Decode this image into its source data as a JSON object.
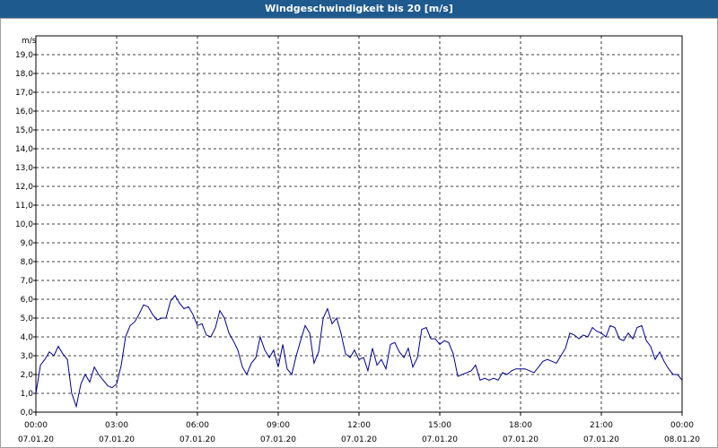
{
  "window": {
    "title": "Windgeschwindigkeit bis 20 [m/s]"
  },
  "colors": {
    "title_bg": "#1e5a8e",
    "line": "#00008b",
    "grid": "#000000"
  },
  "chart_data": {
    "type": "line",
    "title": "Windgeschwindigkeit bis 20 [m/s]",
    "ylabel": "m/s",
    "xlabel": "",
    "ylim": [
      0,
      20
    ],
    "xlim_hours": [
      0,
      24
    ],
    "grid": true,
    "y_ticks": [
      "0,0",
      "1,0",
      "2,0",
      "3,0",
      "4,0",
      "5,0",
      "6,0",
      "7,0",
      "8,0",
      "9,0",
      "10,0",
      "11,0",
      "12,0",
      "13,0",
      "14,0",
      "15,0",
      "16,0",
      "17,0",
      "18,0",
      "19,0"
    ],
    "x_ticks": [
      {
        "time": "00:00",
        "date": "07.01.20"
      },
      {
        "time": "03:00",
        "date": "07.01.20"
      },
      {
        "time": "06:00",
        "date": "07.01.20"
      },
      {
        "time": "09:00",
        "date": "07.01.20"
      },
      {
        "time": "12:00",
        "date": "07.01.20"
      },
      {
        "time": "15:00",
        "date": "07.01.20"
      },
      {
        "time": "18:00",
        "date": "07.01.20"
      },
      {
        "time": "21:00",
        "date": "07.01.20"
      },
      {
        "time": "00:00",
        "date": "08.01.20"
      }
    ],
    "series": [
      {
        "x_hours": [
          0,
          0.17,
          0.33,
          0.5,
          0.67,
          0.83,
          1,
          1.17,
          1.33,
          1.5,
          1.67,
          1.83,
          2,
          2.17,
          2.33,
          2.5,
          2.67,
          2.83,
          3,
          3.17,
          3.33,
          3.5,
          3.67,
          3.83,
          4,
          4.17,
          4.33,
          4.5,
          4.67,
          4.83,
          5,
          5.17,
          5.33,
          5.5,
          5.67,
          5.83,
          6,
          6.17,
          6.33,
          6.5,
          6.67,
          6.83,
          7,
          7.17,
          7.33,
          7.5,
          7.67,
          7.83,
          8,
          8.17,
          8.33,
          8.5,
          8.67,
          8.83,
          9,
          9.17,
          9.33,
          9.5,
          9.67,
          9.83,
          10,
          10.17,
          10.33,
          10.5,
          10.67,
          10.83,
          11,
          11.17,
          11.33,
          11.5,
          11.67,
          11.83,
          12,
          12.17,
          12.33,
          12.5,
          12.67,
          12.83,
          13,
          13.17,
          13.33,
          13.5,
          13.67,
          13.83,
          14,
          14.17,
          14.33,
          14.5,
          14.67,
          14.83,
          15,
          15.17,
          15.33,
          15.5,
          15.67,
          15.83,
          16,
          16.17,
          16.33,
          16.5,
          16.67,
          16.83,
          17,
          17.17,
          17.33,
          17.5,
          17.67,
          17.83,
          18,
          18.17,
          18.33,
          18.5,
          18.67,
          18.83,
          19,
          19.17,
          19.33,
          19.5,
          19.67,
          19.83,
          20,
          20.17,
          20.33,
          20.5,
          20.67,
          20.83,
          21,
          21.17,
          21.33,
          21.5,
          21.67,
          21.83,
          22,
          22.17,
          22.33,
          22.5,
          22.67,
          22.83,
          23,
          23.17,
          23.33,
          23.5,
          23.67,
          23.83,
          24
        ],
        "values": [
          1.0,
          2.5,
          2.8,
          3.2,
          3.0,
          3.5,
          3.1,
          2.8,
          1.0,
          0.3,
          1.5,
          2.0,
          1.6,
          2.4,
          2.0,
          1.7,
          1.4,
          1.3,
          1.5,
          2.5,
          4.0,
          4.6,
          4.8,
          5.2,
          5.7,
          5.6,
          5.2,
          4.9,
          5.0,
          5.0,
          5.9,
          6.2,
          5.8,
          5.5,
          5.6,
          5.2,
          4.6,
          4.7,
          4.1,
          4.0,
          4.5,
          5.4,
          5.0,
          4.2,
          3.8,
          3.3,
          2.4,
          2.0,
          2.6,
          2.9,
          4.0,
          3.3,
          2.9,
          3.3,
          2.4,
          3.6,
          2.3,
          2.0,
          3.0,
          3.8,
          4.6,
          4.2,
          2.6,
          3.2,
          5.0,
          5.5,
          4.7,
          5.0,
          4.2,
          3.1,
          2.9,
          3.3,
          2.8,
          2.9,
          2.2,
          3.4,
          2.5,
          2.8,
          2.3,
          3.6,
          3.7,
          3.2,
          2.9,
          3.4,
          2.4,
          2.9,
          4.4,
          4.5,
          3.9,
          3.9,
          3.6,
          3.8,
          3.7,
          3.1,
          1.9,
          2.0,
          2.1,
          2.2,
          2.5,
          1.7,
          1.8,
          1.7,
          1.8,
          1.7,
          2.1,
          2.0,
          2.2,
          2.3,
          2.3,
          2.3,
          2.2,
          2.1,
          2.4,
          2.7,
          2.8,
          2.7,
          2.6,
          3.0,
          3.4,
          4.2,
          4.1,
          3.9,
          4.1,
          4.0,
          4.5,
          4.3,
          4.2,
          4.0,
          4.6,
          4.5,
          3.9,
          3.8,
          4.2,
          3.9,
          4.5,
          4.6,
          3.8,
          3.5,
          2.8,
          3.2,
          2.7,
          2.3,
          2.0,
          2.0,
          1.7
        ]
      }
    ]
  }
}
